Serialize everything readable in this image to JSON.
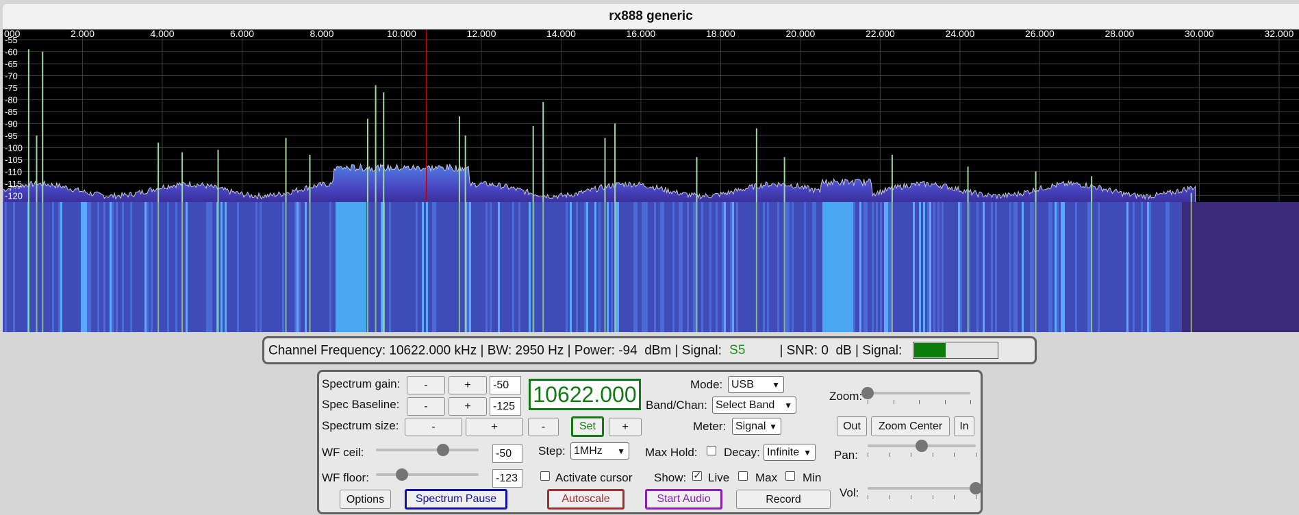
{
  "window": {
    "title": "rx888 generic"
  },
  "colors": {
    "spectrum_fill": "#4a47c4",
    "spectrum_line": "#c8c8d8",
    "cursor_line": "#c00000",
    "waterfall_base": "#3b2a7a",
    "frequency_green": "#137a13",
    "pause_blue": "#1010b0",
    "autoscale_red": "#a03030",
    "audio_purple": "#8a1fb8"
  },
  "chart_data": {
    "type": "line",
    "xlabel": "",
    "ylabel": "",
    "x_ticks": [
      "2.000",
      "4.000",
      "6.000",
      "8.000",
      "10.000",
      "12.000",
      "14.000",
      "16.000",
      "18.000",
      "20.000",
      "22.000",
      "24.000",
      "26.000",
      "28.000",
      "30.000",
      "32.000"
    ],
    "x_first_tick": "000",
    "y_ticks": [
      "-55",
      "-60",
      "-65",
      "-70",
      "-75",
      "-80",
      "-85",
      "-90",
      "-95",
      "-100",
      "-105",
      "-110",
      "-115",
      "-120"
    ],
    "xlim": [
      0,
      32.5
    ],
    "ylim": [
      -122.5,
      -53
    ],
    "cursor_mhz": 10.622,
    "noise_floor_db": -121,
    "peaks": [
      {
        "x": 0.65,
        "y": -59
      },
      {
        "x": 1.0,
        "y": -60
      },
      {
        "x": 0.85,
        "y": -95
      },
      {
        "x": 3.9,
        "y": -98
      },
      {
        "x": 4.5,
        "y": -102
      },
      {
        "x": 5.4,
        "y": -101
      },
      {
        "x": 7.1,
        "y": -96
      },
      {
        "x": 7.7,
        "y": -103
      },
      {
        "x": 9.35,
        "y": -74
      },
      {
        "x": 9.55,
        "y": -77
      },
      {
        "x": 9.15,
        "y": -88
      },
      {
        "x": 11.45,
        "y": -87
      },
      {
        "x": 11.6,
        "y": -95
      },
      {
        "x": 13.55,
        "y": -81
      },
      {
        "x": 13.3,
        "y": -91
      },
      {
        "x": 15.35,
        "y": -90
      },
      {
        "x": 15.1,
        "y": -96
      },
      {
        "x": 17.4,
        "y": -104
      },
      {
        "x": 18.9,
        "y": -92
      },
      {
        "x": 19.6,
        "y": -104
      },
      {
        "x": 22.3,
        "y": -103
      },
      {
        "x": 24.2,
        "y": -108
      },
      {
        "x": 25.9,
        "y": -110
      },
      {
        "x": 27.3,
        "y": -112
      },
      {
        "x": 29.8,
        "y": -119
      }
    ],
    "hump_regions": [
      {
        "x0": 8.3,
        "x1": 11.7,
        "y": -109
      },
      {
        "x0": 20.5,
        "x1": 21.8,
        "y": -115
      }
    ]
  },
  "info_bar": {
    "channel_frequency": "Channel Frequency: 10622.000 kHz",
    "bw": "| BW: 2950 Hz",
    "power": "| Power: -94",
    "dbm_signal": "dBm | Signal:",
    "signal_s": "S5",
    "snr": "| SNR: 0",
    "db_signal": "dB | Signal:",
    "signal_meter_fraction": 0.38
  },
  "controls": {
    "spectrum_gain_label": "Spectrum gain:",
    "spec_baseline_label": "Spec Baseline:",
    "spectrum_size_label": "Spectrum size:",
    "minus": "-",
    "plus": "+",
    "spectrum_gain_value": "-50",
    "spec_baseline_value": "-125",
    "frequency": "10622.000",
    "set_label": "Set",
    "mode_label": "Mode:",
    "mode_value": "USB",
    "band_label": "Band/Chan:",
    "band_value": "Select Band",
    "meter_label": "Meter:",
    "meter_value": "Signal",
    "zoom_label": "Zoom:",
    "zoom_value": 0.0,
    "out_label": "Out",
    "zoom_center_label": "Zoom Center",
    "in_label": "In",
    "wf_ceil_label": "WF ceil:",
    "wf_ceil_value": "-50",
    "wf_ceil_slider": 0.65,
    "wf_floor_label": "WF floor:",
    "wf_floor_value": "-123",
    "wf_floor_slider": 0.25,
    "step_label": "Step:",
    "step_value": "1MHz",
    "max_hold_label": "Max Hold:",
    "decay_label": "Decay:",
    "decay_value": "Infinite",
    "pan_label": "Pan:",
    "pan_value": 0.5,
    "activate_cursor_label": "Activate cursor",
    "show_label": "Show:",
    "live_label": "Live",
    "max_label": "Max",
    "min_label": "Min",
    "vol_label": "Vol:",
    "vol_value": 1.0,
    "options_label": "Options",
    "spectrum_pause_label": "Spectrum Pause",
    "autoscale_label": "Autoscale",
    "start_audio_label": "Start Audio",
    "record_label": "Record"
  }
}
